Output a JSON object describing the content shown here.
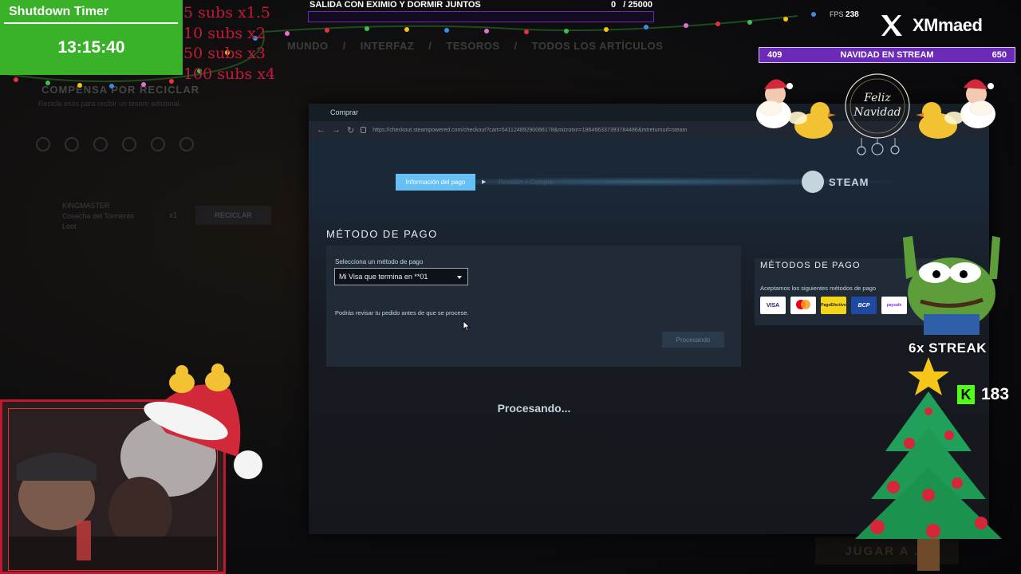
{
  "timer": {
    "title": "Shutdown Timer",
    "time": "13:15:40"
  },
  "subs": [
    "5 subs x1.5",
    "10 subs x2",
    "50 subs x3",
    "100 subs x4"
  ],
  "goal": {
    "title": "SALIDA CON EXIMIO Y DORMIR JUNTOS",
    "current": "0",
    "target": "/ 25000",
    "progress": 0.0
  },
  "fps": {
    "label": "FPS",
    "value": "238"
  },
  "brand": {
    "name": "XMmaed",
    "icon": "x-logo-icon"
  },
  "navidad_bar": {
    "left": "409",
    "title": "NAVIDAD EN STREAM",
    "right": "650"
  },
  "background_game": {
    "tabs": [
      "MUNDO",
      "/",
      "INTERFAZ",
      "/",
      "TESOROS",
      "/",
      "TODOS LOS ARTÍCULOS"
    ],
    "recycle_title": "COMPENSA POR RECICLAR",
    "recycle_sub": "Recicla esos para recibir un tesoro adicional.",
    "item": {
      "tag": "KINGMASTER",
      "name": "Cosecha del Tormento",
      "type": "Loot",
      "qty": "x1"
    },
    "recycle_button": "RECICLAR",
    "play_button": "JUGAR A ..."
  },
  "steam": {
    "window_title": "Comprar",
    "url": "https://checkout.steampowered.com/checkout?cart=54112489290066178&microtxn=186466337393784486&mtreturnurl=steam",
    "steps": {
      "active": "Información del pago",
      "next": "Revisión + Compra"
    },
    "logo_text": "STEAM",
    "payment": {
      "title": "MÉTODO DE PAGO",
      "select_label": "Selecciona un método de pago",
      "selected": "Mi Visa que termina en **01",
      "note": "Podrás revisar tu pedido antes de que se procese.",
      "button": "Procesando"
    },
    "processing_text": "Procesando...",
    "methods": {
      "title": "MÉTODOS DE PAGO",
      "subtitle": "Aceptamos los siguientes métodos de pago",
      "cards": [
        "VISA",
        "mastercard",
        "PagoEfectivo",
        "BCP",
        "paysafe"
      ]
    }
  },
  "overlay": {
    "wreath_text": "Feliz Navidad",
    "streak": "6x STREAK",
    "kick_count": "183"
  },
  "colors": {
    "timer_bg": "#39b129",
    "subs_text": "#c21a3a",
    "goal_border": "#6b2bb8",
    "steam_accent": "#66c0f4",
    "kick_green": "#53fc18"
  }
}
